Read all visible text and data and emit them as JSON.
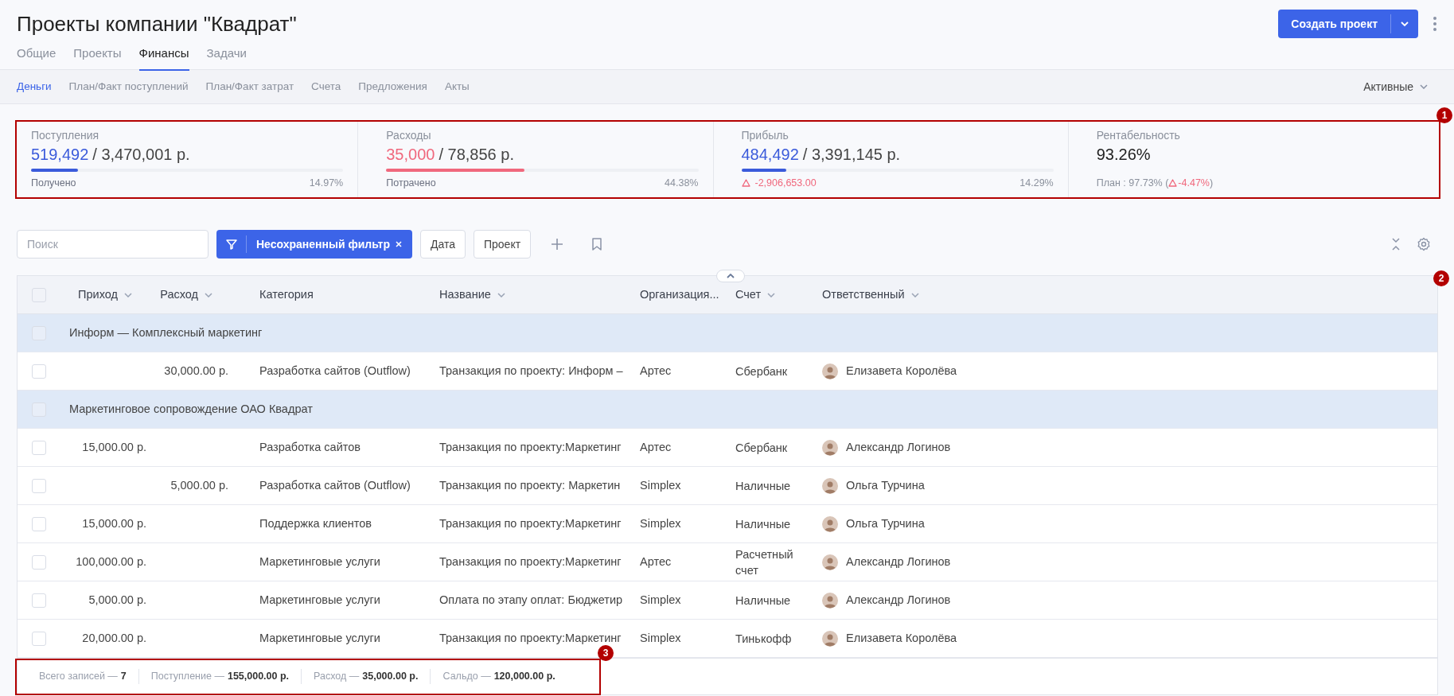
{
  "page_title": "Проекты компании \"Квадрат\"",
  "create_button": {
    "label": "Создать проект"
  },
  "tabs": [
    {
      "label": "Общие",
      "selected": false
    },
    {
      "label": "Проекты",
      "selected": false
    },
    {
      "label": "Финансы",
      "selected": true
    },
    {
      "label": "Задачи",
      "selected": false
    }
  ],
  "subtabs": [
    {
      "label": "Деньги",
      "selected": true
    },
    {
      "label": "План/Факт поступлений",
      "selected": false
    },
    {
      "label": "План/Факт затрат",
      "selected": false
    },
    {
      "label": "Счета",
      "selected": false
    },
    {
      "label": "Предложения",
      "selected": false
    },
    {
      "label": "Акты",
      "selected": false
    }
  ],
  "status_filter": {
    "label": "Активные"
  },
  "stats": [
    {
      "kind": "progress",
      "title": "Поступления",
      "value": "519,492",
      "total": "/ 3,470,001 р.",
      "color": "#3b5bdb",
      "level": 0.1497,
      "caption": "Получено",
      "alert": false,
      "percent": "14.97%"
    },
    {
      "kind": "progress",
      "title": "Расходы",
      "value": "35,000",
      "total": "/ 78,856 р.",
      "color": "#f0687d",
      "level": 0.4438,
      "caption": "Потрачено",
      "alert": false,
      "percent": "44.38%"
    },
    {
      "kind": "progress",
      "title": "Прибыль",
      "value": "484,492",
      "total": "/ 3,391,145 р.",
      "color": "#3b5bdb",
      "level": 0.1429,
      "caption": "-2,906,653.00",
      "alert": true,
      "percent": "14.29%"
    },
    {
      "kind": "plain",
      "title": "Рентабельность",
      "value": "93.26%",
      "plan": "План : 97.73% (",
      "delta": "-4.47%",
      "plan_end": ")"
    }
  ],
  "toolbar": {
    "search": {
      "placeholder": "Поиск"
    },
    "filter_chip": {
      "label": "Несохраненный фильтр"
    },
    "buttons": [
      "Дата",
      "Проект"
    ]
  },
  "table": {
    "select_all": {
      "checked": false
    },
    "columns": [
      {
        "label": "Приход",
        "sortable": true
      },
      {
        "label": "Расход",
        "sortable": true
      },
      {
        "label": "Категория",
        "sortable": false
      },
      {
        "label": "Название",
        "sortable": true
      },
      {
        "label": "Организация...",
        "sortable": false
      },
      {
        "label": "Счет",
        "sortable": true
      },
      {
        "label": "Ответственный",
        "sortable": true
      }
    ],
    "rows": [
      {
        "kind": "group",
        "checked": false,
        "label": "Информ — Комплексный маркетинг"
      },
      {
        "kind": "item",
        "checked": false,
        "expense": "30,000.00 р.",
        "category": "Разработка сайтов (Outflow)",
        "name": "Транзакция по проекту: Информ –",
        "organization": "Артес",
        "account": "Сбербанк",
        "responsible": "Елизавета Королёва"
      },
      {
        "kind": "group",
        "checked": false,
        "label": "Маркетинговое сопровождение ОАО Квадрат"
      },
      {
        "kind": "item",
        "checked": false,
        "income": "15,000.00 р.",
        "category": "Разработка сайтов",
        "name": "Транзакция по проекту:Маркетинг",
        "organization": "Артес",
        "account": "Сбербанк",
        "responsible": "Александр Логинов"
      },
      {
        "kind": "item",
        "checked": false,
        "expense": "5,000.00 р.",
        "category": "Разработка сайтов (Outflow)",
        "name": "Транзакция по проекту: Маркетин",
        "organization": "Simplex",
        "account": "Наличные",
        "responsible": "Ольга Турчина"
      },
      {
        "kind": "item",
        "checked": false,
        "income": "15,000.00 р.",
        "category": "Поддержка клиентов",
        "name": "Транзакция по проекту:Маркетинг",
        "organization": "Simplex",
        "account": "Наличные",
        "responsible": "Ольга Турчина"
      },
      {
        "kind": "item",
        "checked": false,
        "income": "100,000.00 р.",
        "category": "Маркетинговые услуги",
        "name": "Транзакция по проекту:Маркетинг",
        "organization": "Артес",
        "account": "Расчетный счет",
        "responsible": "Александр Логинов"
      },
      {
        "kind": "item",
        "checked": false,
        "income": "5,000.00 р.",
        "category": "Маркетинговые услуги",
        "name": "Оплата по этапу оплат: Бюджетир",
        "organization": "Simplex",
        "account": "Наличные",
        "responsible": "Александр Логинов"
      },
      {
        "kind": "item",
        "checked": false,
        "income": "20,000.00 р.",
        "category": "Маркетинговые услуги",
        "name": "Транзакция по проекту:Маркетинг",
        "organization": "Simplex",
        "account": "Тинькофф",
        "responsible": "Елизавета Королёва"
      }
    ],
    "totals": [
      {
        "label": "Всего записей —",
        "value": "7"
      },
      {
        "label": "Поступление —",
        "value": "155,000.00 р."
      },
      {
        "label": "Расход —",
        "value": "35,000.00 р."
      },
      {
        "label": "Сальдо —",
        "value": "120,000.00 р."
      }
    ]
  },
  "annotations": [
    {
      "label": "1"
    },
    {
      "label": "2"
    },
    {
      "label": "3"
    }
  ]
}
